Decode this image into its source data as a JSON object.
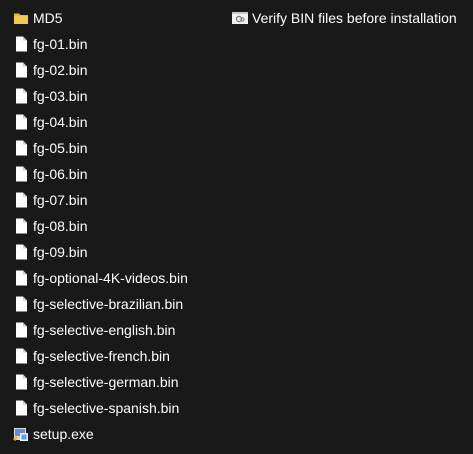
{
  "files": [
    {
      "name": "MD5",
      "icon": "folder-icon"
    },
    {
      "name": "fg-01.bin",
      "icon": "file-icon"
    },
    {
      "name": "fg-02.bin",
      "icon": "file-icon"
    },
    {
      "name": "fg-03.bin",
      "icon": "file-icon"
    },
    {
      "name": "fg-04.bin",
      "icon": "file-icon"
    },
    {
      "name": "fg-05.bin",
      "icon": "file-icon"
    },
    {
      "name": "fg-06.bin",
      "icon": "file-icon"
    },
    {
      "name": "fg-07.bin",
      "icon": "file-icon"
    },
    {
      "name": "fg-08.bin",
      "icon": "file-icon"
    },
    {
      "name": "fg-09.bin",
      "icon": "file-icon"
    },
    {
      "name": "fg-optional-4K-videos.bin",
      "icon": "file-icon"
    },
    {
      "name": "fg-selective-brazilian.bin",
      "icon": "file-icon"
    },
    {
      "name": "fg-selective-english.bin",
      "icon": "file-icon"
    },
    {
      "name": "fg-selective-french.bin",
      "icon": "file-icon"
    },
    {
      "name": "fg-selective-german.bin",
      "icon": "file-icon"
    },
    {
      "name": "fg-selective-spanish.bin",
      "icon": "file-icon"
    },
    {
      "name": "setup.exe",
      "icon": "installer-icon"
    }
  ],
  "verify": {
    "name": "Verify BIN files before installation",
    "icon": "script-icon"
  },
  "colors": {
    "background": "#191919",
    "text": "#ffffff",
    "folder": "#e8b83c",
    "file": "#ffffff"
  }
}
